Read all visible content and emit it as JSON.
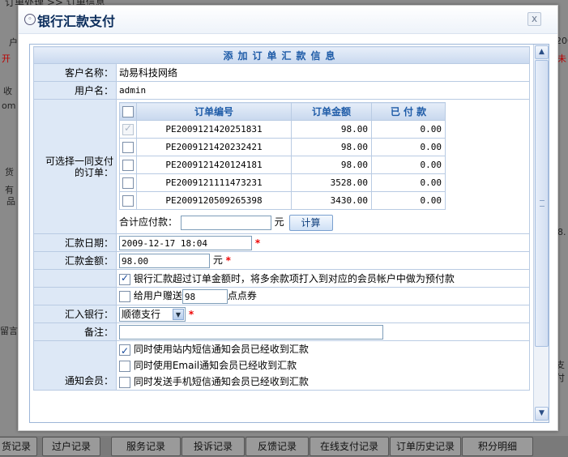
{
  "background": {
    "crumb": "订单处理 >> 订单信息",
    "side_texts": [
      "户",
      "开",
      "收",
      "om",
      "货",
      "有",
      "品",
      "留言"
    ],
    "right_texts": [
      "200",
      "未",
      "8.",
      "支付"
    ],
    "bottom_tabs": [
      "货记录",
      "过户记录",
      "服务记录",
      "投诉记录",
      "反馈记录",
      "在线支付记录",
      "订单历史记录",
      "积分明细"
    ]
  },
  "dialog": {
    "title": "银行汇款支付",
    "close_label": "x"
  },
  "form": {
    "header": "添加订单汇款信息",
    "customer_label": "客户名称：",
    "customer_value": "动易科技网络",
    "username_label": "用户名：",
    "username_value": "admin",
    "orders_label": "可选择一同支付的订单：",
    "orders_columns": [
      "订单编号",
      "订单金额",
      "已 付 款"
    ],
    "orders": [
      {
        "no": "PE2009121420251831",
        "amount": "98.00",
        "paid": "0.00",
        "checked": true,
        "disabled": true
      },
      {
        "no": "PE2009121420232421",
        "amount": "98.00",
        "paid": "0.00",
        "checked": false,
        "disabled": false
      },
      {
        "no": "PE2009121420124181",
        "amount": "98.00",
        "paid": "0.00",
        "checked": false,
        "disabled": false
      },
      {
        "no": "PE2009121111473231",
        "amount": "3528.00",
        "paid": "0.00",
        "checked": false,
        "disabled": false
      },
      {
        "no": "PE2009120509265398",
        "amount": "3430.00",
        "paid": "0.00",
        "checked": false,
        "disabled": false
      }
    ],
    "total_label": "合计应付款：",
    "total_value": "",
    "yuan": "元",
    "calc_button": "计算",
    "date_label": "汇款日期：",
    "date_value": "2009-12-17 18:04",
    "amount_label": "汇款金额：",
    "amount_value": "98.00",
    "amount_unit": "元",
    "required_mark": "*",
    "overpay_text": "银行汇款超过订单金额时，将多余款项打入到对应的会员帐户中做为预付款",
    "overpay_checked": true,
    "gift_prefix": "给用户赠送",
    "gift_value": "98",
    "gift_suffix": "点点券",
    "gift_checked": false,
    "bank_label": "汇入银行：",
    "bank_value": "顺德支行",
    "remark_label": "备注：",
    "remark_value": "",
    "notify_label": "通知会员：",
    "notify_options": [
      {
        "text": "同时使用站内短信通知会员已经收到汇款",
        "checked": true
      },
      {
        "text": "同时使用Email通知会员已经收到汇款",
        "checked": false
      },
      {
        "text": "同时发送手机短信通知会员已经收到汇款",
        "checked": false
      }
    ]
  }
}
